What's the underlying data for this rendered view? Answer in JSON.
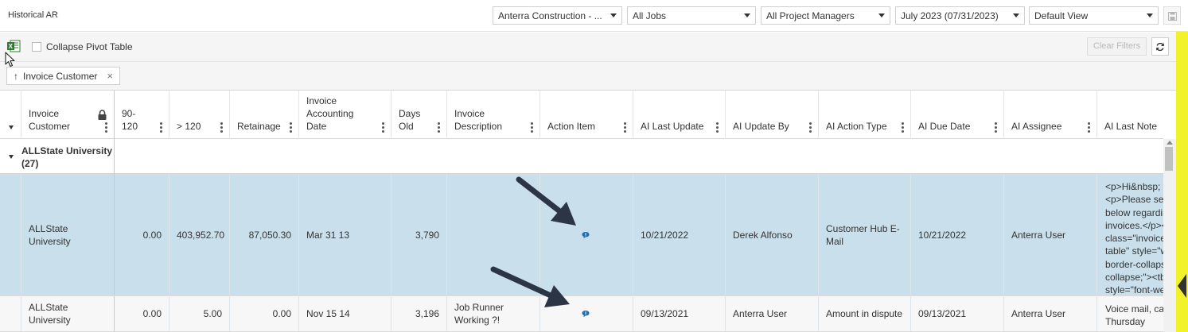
{
  "app_title": "Historical AR",
  "filters": {
    "company": "Anterra Construction - ...",
    "jobs": "All Jobs",
    "project_managers": "All Project Managers",
    "period": "July 2023 (07/31/2023)",
    "view": "Default View"
  },
  "toolbar": {
    "collapse_label": "Collapse Pivot Table",
    "clear_filters_label": "Clear Filters"
  },
  "group_chip": {
    "label": "Invoice Customer",
    "arrow": "↑",
    "remove": "×"
  },
  "columns": {
    "invoice_customer": "Invoice\nCustomer",
    "d90_120": "90-\n120",
    "over_120": "> 120",
    "retainage": "Retainage",
    "invoice_accounting_date": "Invoice\nAccounting\nDate",
    "days_old": "Days\nOld",
    "invoice_description": "Invoice\nDescription",
    "action_item": "Action Item",
    "ai_last_update": "AI Last Update",
    "ai_update_by": "AI Update By",
    "ai_action_type": "AI Action Type",
    "ai_due_date": "AI Due Date",
    "ai_assignee": "AI Assignee",
    "ai_last_note": "AI Last Note"
  },
  "group": {
    "label": "ALLState University\n(27)"
  },
  "rows": [
    {
      "invoice_customer": "ALLState\nUniversity",
      "d90_120": "0.00",
      "over_120": "403,952.70",
      "retainage": "87,050.30",
      "invoice_accounting_date": "Mar 31 13",
      "days_old": "3,790",
      "invoice_description": "",
      "ai_last_update": "10/21/2022",
      "ai_update_by": "Derek Alfonso",
      "ai_action_type": "Customer Hub E-\nMail",
      "ai_due_date": "10/21/2022",
      "ai_assignee": "Anterra User",
      "ai_last_note": "<p>Hi&nbsp; D\n<p>Please see\nbelow regardin\ninvoices.</p><p\nclass=\"invoices\ntable\" style=\"w\nborder-collapse\ncollapse;\"><tbo\nstyle=\"font-wei"
    },
    {
      "invoice_customer": "ALLState\nUniversity",
      "d90_120": "0.00",
      "over_120": "5.00",
      "retainage": "0.00",
      "invoice_accounting_date": "Nov 15 14",
      "days_old": "3,196",
      "invoice_description": "Job Runner\nWorking ?!",
      "ai_last_update": "09/13/2021",
      "ai_update_by": "Anterra User",
      "ai_action_type": "Amount in dispute",
      "ai_due_date": "09/13/2021",
      "ai_assignee": "Anterra User",
      "ai_last_note": "Voice mail, call\nThursday"
    }
  ],
  "colors": {
    "selected_row": "#c9e0ec",
    "accent_panel": "#f2f22a",
    "icon_blue": "#1f6fb5",
    "arrow": "#2b3545"
  },
  "icons": [
    "excel-icon",
    "save-icon",
    "refresh-icon",
    "lock-icon",
    "message-icon",
    "cursor-icon"
  ]
}
